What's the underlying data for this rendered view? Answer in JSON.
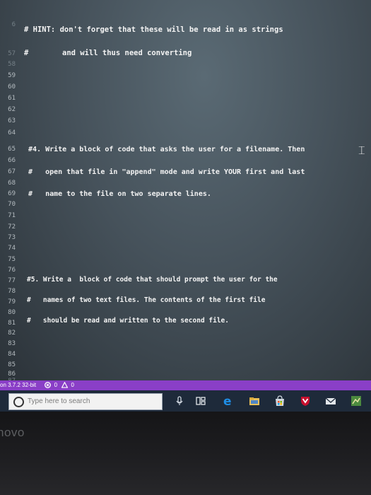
{
  "editor": {
    "line_numbers": [
      "6",
      "57",
      "58",
      "59",
      "60",
      "61",
      "62",
      "63",
      "64",
      "65",
      "66",
      "67",
      "68",
      "69",
      "70",
      "71",
      "72",
      "73",
      "74",
      "75",
      "76",
      "77",
      "78",
      "79",
      "80",
      "81",
      "82",
      "83",
      "84",
      "85",
      "86",
      "87"
    ],
    "lines": {
      "hint_1": "# HINT: don't forget that these will be read in as strings",
      "hint_2_hash": "#",
      "hint_2_text": "and will thus need converting",
      "q4_1": "#4. Write a block of code that asks the user for a filename. Then",
      "q4_2": "#   open that file in \"append\" mode and write YOUR first and last",
      "q4_3": "#   name to the file on two separate lines.",
      "q5_1": "#5. Write a  block of code that should prompt the user for the",
      "q5_2": "#   names of two text files. The contents of the first file",
      "q5_3": "#   should be read and written to the second file."
    }
  },
  "statusbar": {
    "python_version": "on 3.7.2 32-bit",
    "errors": "0",
    "warnings": "0"
  },
  "taskbar": {
    "search_placeholder": "Type here to search"
  },
  "laptop": {
    "brand": "novo"
  },
  "colors": {
    "statusbar": "#8a3fc7",
    "taskbar": "#1e2a3a"
  }
}
